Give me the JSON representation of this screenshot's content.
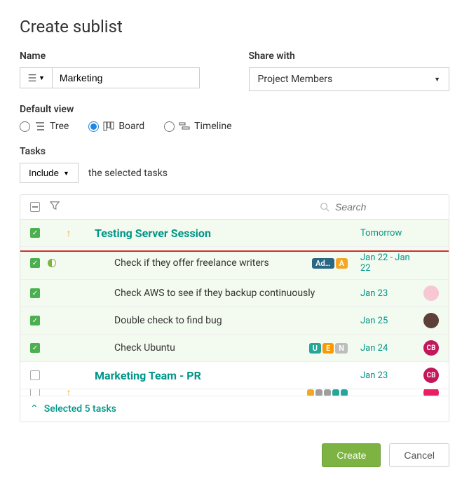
{
  "title": "Create sublist",
  "form": {
    "name_label": "Name",
    "name_value": "Marketing",
    "share_label": "Share with",
    "share_value": "Project Members"
  },
  "view": {
    "label": "Default view",
    "options": {
      "tree": "Tree",
      "board": "Board",
      "timeline": "Timeline"
    },
    "selected": "board"
  },
  "tasks": {
    "label": "Tasks",
    "include": "Include",
    "help": "the selected tasks",
    "search_placeholder": "Search",
    "rows": [
      {
        "title": "Testing Server Session",
        "date": "Tomorrow",
        "is_group": true,
        "checked": true,
        "arrow": true
      },
      {
        "title": "Check if they offer freelance writers",
        "date": "Jan 22 - Jan 22",
        "checked": true,
        "half": true,
        "pills": [
          {
            "text": "Ad…",
            "color": "#2a6783"
          },
          {
            "text": "A",
            "color": "#f5a623"
          }
        ]
      },
      {
        "title": "Check AWS to see if they backup continuously",
        "date": "Jan 23",
        "checked": true,
        "avatar_bg": "#f8c7d4"
      },
      {
        "title": "Double check to find bug",
        "date": "Jan 25",
        "checked": true,
        "avatar_bg": "#5d4037"
      },
      {
        "title": "Check Ubuntu",
        "date": "Jan 24",
        "checked": true,
        "pills": [
          {
            "text": "U",
            "color": "#26a69a"
          },
          {
            "text": "E",
            "color": "#ff9800"
          },
          {
            "text": "N",
            "color": "#bdbdbd"
          }
        ],
        "avatar_text": "CB",
        "avatar_bg": "#c2185b"
      },
      {
        "title": "Marketing Team - PR",
        "date": "Jan 23",
        "is_group": true,
        "checked": false,
        "avatar_text": "CB",
        "avatar_bg": "#c2185b"
      },
      {
        "title": "",
        "date": "",
        "checked": false,
        "arrow": true,
        "dots": [
          "#f5a623",
          "#9e9e9e",
          "#9e9e9e",
          "#26a69a",
          "#26a69a"
        ],
        "avatar_bg": "#e91e63",
        "partial": true
      }
    ],
    "footer": "Selected 5 tasks"
  },
  "actions": {
    "create": "Create",
    "cancel": "Cancel"
  }
}
